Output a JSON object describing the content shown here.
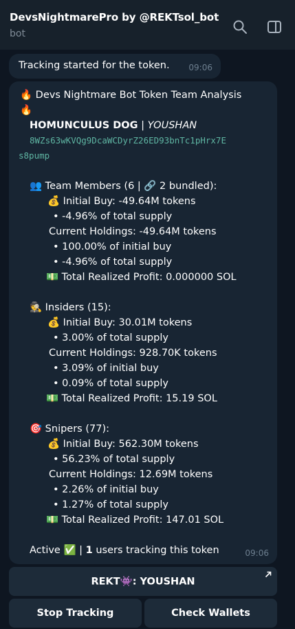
{
  "header": {
    "title": "DevsNightmarePro by @REKTsol_bot",
    "subtitle": "bot",
    "icons": [
      "search-icon",
      "sidebar-toggle-icon"
    ]
  },
  "messages": {
    "tracking_started": {
      "text": "Tracking started for the token.",
      "time": "09:06"
    },
    "analysis": {
      "title_emoji": "🔥",
      "title_text": "Devs Nightmare Bot Token Team Analysis",
      "title_emoji_2": "🔥",
      "token_name": "HOMUNCULUS DOG",
      "token_sep": " | ",
      "token_symbol": "YOUSHAN",
      "address_line1": "8WZs63wKVQg9DcaWCDyrZ26ED93bnTc1pHrx7E",
      "address_line2": "s8pump",
      "team": {
        "emoji": "👥",
        "heading": "Team Members (6 | 🔗 2 bundled):",
        "initial_buy": "💰 Initial Buy: -49.64M tokens",
        "initial_supply": "• -4.96% of total supply",
        "current_holdings": "Current Holdings: -49.64M tokens",
        "pct_initial": "• 100.00% of initial buy",
        "pct_supply": "• -4.96% of total supply",
        "profit": "💵 Total Realized Profit: 0.000000 SOL"
      },
      "insiders": {
        "emoji": "🕵",
        "heading": "Insiders (15):",
        "initial_buy": "💰 Initial Buy: 30.01M tokens",
        "initial_supply": "• 3.00% of total supply",
        "current_holdings": "Current Holdings: 928.70K tokens",
        "pct_initial": "• 3.09% of initial buy",
        "pct_supply": "• 0.09% of total supply",
        "profit": "💵 Total Realized Profit: 15.19 SOL"
      },
      "snipers": {
        "emoji": "🎯",
        "heading": "Snipers (77):",
        "initial_buy": "💰 Initial Buy: 562.30M tokens",
        "initial_supply": "• 56.23% of total supply",
        "current_holdings": "Current Holdings: 12.69M tokens",
        "pct_initial": "• 2.26% of initial buy",
        "pct_supply": "• 1.27% of total supply",
        "profit": "💵 Total Realized Profit: 147.01 SOL"
      },
      "footer_active": "Active ✅ | ",
      "footer_count": "1",
      "footer_rest": " users tracking this token",
      "time": "09:06"
    }
  },
  "keyboard": {
    "link_button": "REKT👾: YOUSHAN",
    "stop_button": "Stop Tracking",
    "check_button": "Check Wallets"
  },
  "colors": {
    "background": "#0e1621",
    "header": "#17212b",
    "bubble": "#182533",
    "button": "#1d2b39",
    "address": "#5fb6a3",
    "muted": "#7f8b97"
  }
}
